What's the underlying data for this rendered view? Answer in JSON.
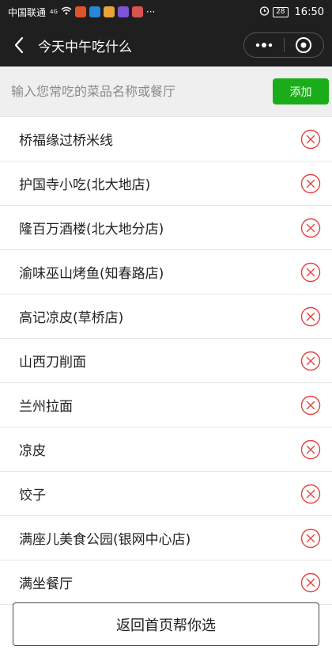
{
  "status_bar": {
    "carrier": "中国联通",
    "network": "4G",
    "more": "···",
    "battery": "28",
    "time": "16:50",
    "app_colors": [
      "#e0542b",
      "#2a86d8",
      "#e8a23a",
      "#7f52d8",
      "#d9534f"
    ]
  },
  "nav": {
    "title": "今天中午吃什么"
  },
  "input": {
    "placeholder": "输入您常吃的菜品名称或餐厅",
    "add_label": "添加"
  },
  "items": [
    "桥福缘过桥米线",
    "护国寺小吃(北大地店)",
    "隆百万酒楼(北大地分店)",
    "渝味巫山烤鱼(知春路店)",
    "高记凉皮(草桥店)",
    "山西刀削面",
    "兰州拉面",
    "凉皮",
    "饺子",
    "满座儿美食公园(银网中心店)",
    "满坐餐厅"
  ],
  "bottom_button": "返回首页帮你选",
  "colors": {
    "accent_green": "#1aad19",
    "delete_red": "#e64340",
    "bar_dark": "#1f1f1f"
  }
}
